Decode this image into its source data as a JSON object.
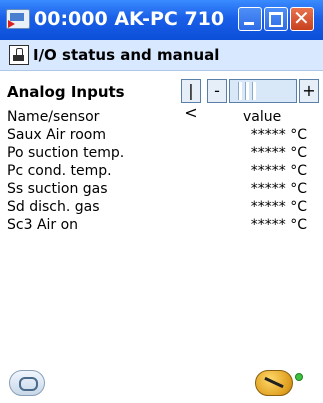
{
  "window": {
    "title": "00:000 AK-PC 710"
  },
  "header": {
    "title": "I/O status and manual"
  },
  "section": {
    "title": "Analog Inputs"
  },
  "nav": {
    "first_label": "|<",
    "prev_label": "-",
    "next_label": "+"
  },
  "table": {
    "headers": [
      "Name/sensor",
      "value"
    ],
    "rows": [
      {
        "name": "Saux Air room",
        "value": "***** °C"
      },
      {
        "name": "Po suction temp.",
        "value": "***** °C"
      },
      {
        "name": "Pc cond. temp.",
        "value": "***** °C"
      },
      {
        "name": "Ss suction gas",
        "value": "***** °C"
      },
      {
        "name": "Sd disch. gas",
        "value": "***** °C"
      },
      {
        "name": "Sc3 Air on",
        "value": "***** °C"
      }
    ]
  },
  "colors": {
    "titlebar": "#1a5fe8",
    "header_bg": "#d8e8ff",
    "led": "#40c040"
  },
  "icons": [
    "app-icon",
    "io-status-icon",
    "glasses-icon",
    "service-key-icon",
    "status-led"
  ]
}
